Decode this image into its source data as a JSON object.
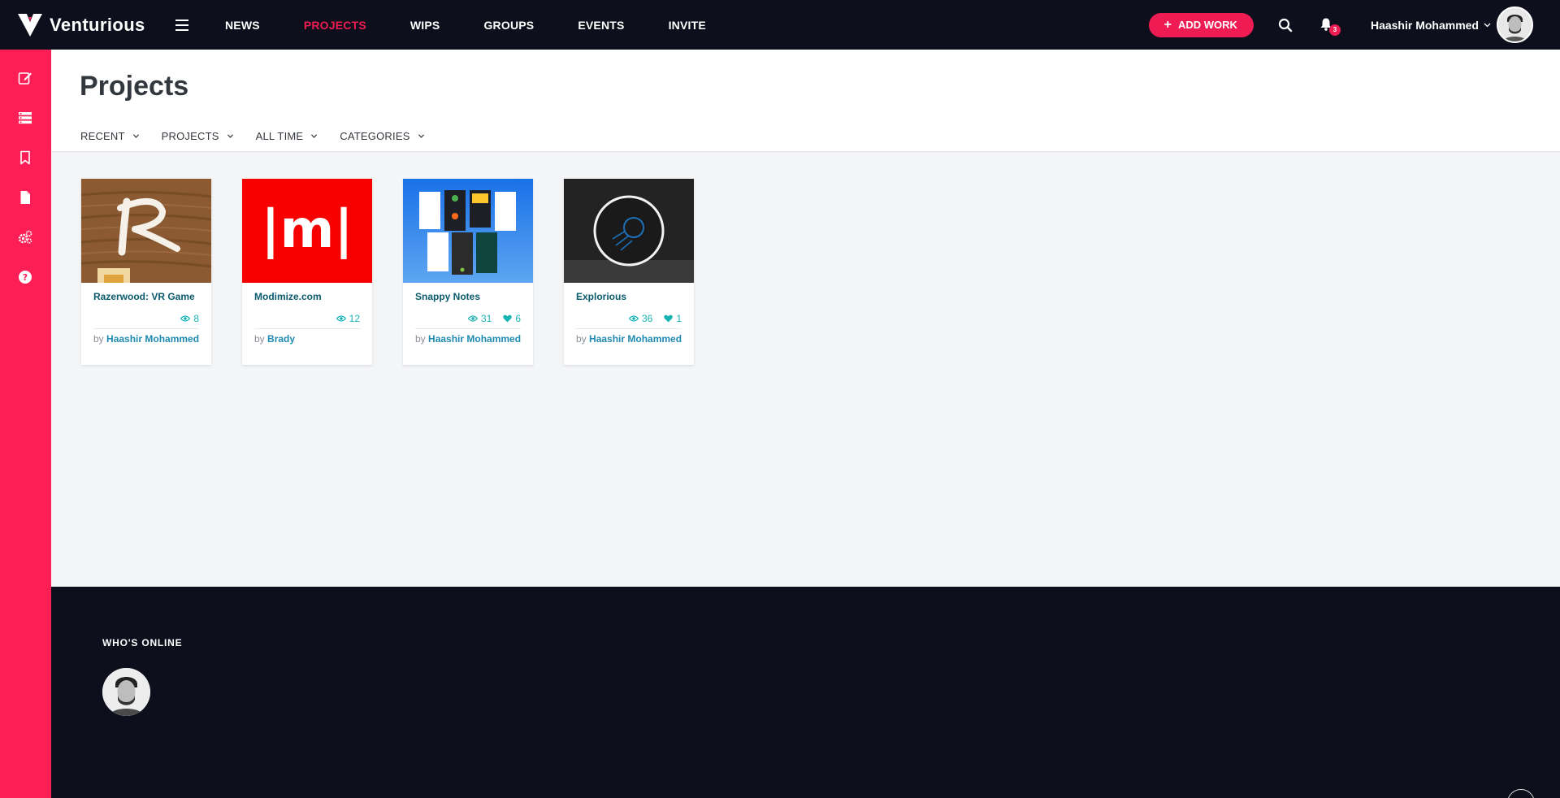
{
  "brand": {
    "name": "Venturious"
  },
  "nav": {
    "items": [
      {
        "label": "NEWS"
      },
      {
        "label": "PROJECTS"
      },
      {
        "label": "WIPS"
      },
      {
        "label": "GROUPS"
      },
      {
        "label": "EVENTS"
      },
      {
        "label": "INVITE"
      }
    ],
    "active": "PROJECTS"
  },
  "header_right": {
    "add_work_label": "ADD WORK",
    "notification_count": "3",
    "user_name": "Haashir Mohammed"
  },
  "sidebar": {
    "icons": [
      "edit-icon",
      "list-icon",
      "bookmark-icon",
      "document-icon",
      "settings-icon",
      "help-icon"
    ]
  },
  "page": {
    "title": "Projects",
    "filters": [
      {
        "label": "RECENT"
      },
      {
        "label": "PROJECTS"
      },
      {
        "label": "ALL TIME"
      },
      {
        "label": "CATEGORIES"
      }
    ]
  },
  "projects": [
    {
      "title": "Razerwood: VR Game",
      "views": "8",
      "likes": null,
      "by_prefix": "by",
      "author": "Haashir Mohammed"
    },
    {
      "title": "Modimize.com",
      "views": "12",
      "likes": null,
      "by_prefix": "by",
      "author": "Brady"
    },
    {
      "title": "Snappy Notes",
      "views": "31",
      "likes": "6",
      "by_prefix": "by",
      "author": "Haashir Mohammed"
    },
    {
      "title": "Explorious",
      "views": "36",
      "likes": "1",
      "by_prefix": "by",
      "author": "Haashir Mohammed"
    }
  ],
  "thumb_text": {
    "modimize": "|m|",
    "razerwood": "R"
  },
  "footer": {
    "online_title": "WHO'S ONLINE"
  },
  "colors": {
    "accent": "#ee1c53",
    "sidebar": "#fe1e56",
    "dark": "#0d0f1c",
    "stat": "#18b3b3",
    "title": "#0a5a6e",
    "author": "#1f8ab0"
  }
}
